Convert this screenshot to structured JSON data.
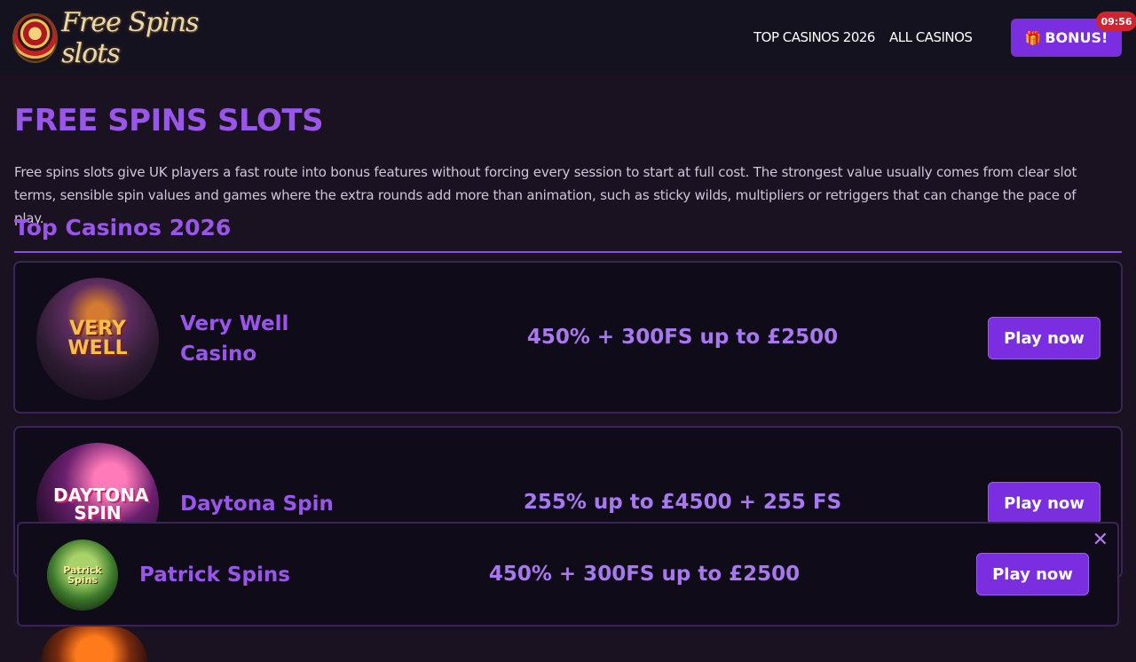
{
  "header": {
    "logo_text": "Free Spins slots",
    "nav": [
      "TOP CASINOS 2026",
      "ALL CASINOS"
    ],
    "bonus_label": "BONUS!",
    "timer": "09:56"
  },
  "main": {
    "title": "FREE SPINS SLOTS",
    "intro": "Free spins slots give UK players a fast route into bonus features without forcing every session to start at full cost. The strongest value usually comes from clear slot terms, sensible spin values and games where the extra rounds add more than animation, such as sticky wilds, multipliers or retriggers that can change the pace of play.",
    "section_title": "Top Casinos 2026"
  },
  "casinos": [
    {
      "logo_text": "VERY WELL",
      "name": "Very Well Casino",
      "offer": "450% + 300FS up to £2500",
      "cta": "Play now"
    },
    {
      "logo_text": "DAYTONA SPIN",
      "name": "Daytona Spin",
      "offer": "255% up to £4500 + 255 FS",
      "cta": "Play now"
    }
  ],
  "sticky": {
    "logo_text": "Patrick Spins",
    "name": "Patrick Spins",
    "offer": "450% + 300FS up to £2500",
    "cta": "Play now",
    "close_icon": "✕"
  },
  "icons": {
    "gift": "gift-icon",
    "close": "close-icon"
  },
  "colors": {
    "accent": "#7a2ee0",
    "title": "#9a55ec",
    "badge": "#d0252f",
    "background": "#1a1220"
  }
}
